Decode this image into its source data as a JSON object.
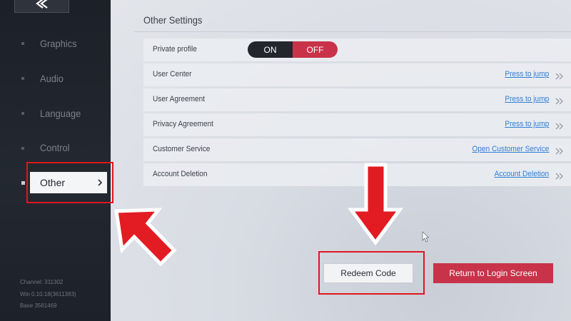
{
  "sidebar": {
    "items": [
      {
        "label": "Graphics"
      },
      {
        "label": "Audio"
      },
      {
        "label": "Language"
      },
      {
        "label": "Control"
      },
      {
        "label": "Other"
      }
    ],
    "active_index": 4,
    "back_icon": "back-arrow-icon",
    "version": {
      "channel": "Channel: 311302",
      "win": "Win 0.10.18(3611383)",
      "base": "Base 3561469"
    }
  },
  "main": {
    "title": "Other Settings",
    "rows": [
      {
        "label": "Private profile",
        "toggle": {
          "on_label": "ON",
          "off_label": "OFF",
          "selected": "OFF"
        }
      },
      {
        "label": "User Center",
        "action": "Press to jump"
      },
      {
        "label": "User Agreement",
        "action": "Press to jump"
      },
      {
        "label": "Privacy Agreement",
        "action": "Press to jump"
      },
      {
        "label": "Customer Service",
        "action": "Open Customer Service"
      },
      {
        "label": "Account Deletion",
        "action": "Account Deletion"
      }
    ],
    "buttons": {
      "redeem": "Redeem Code",
      "return_login": "Return to Login Screen"
    }
  },
  "colors": {
    "accent_red": "#c8334a",
    "link_blue": "#2f7fd6",
    "annotation_red": "#e0161e",
    "sidebar_bg": "#1f232b"
  }
}
